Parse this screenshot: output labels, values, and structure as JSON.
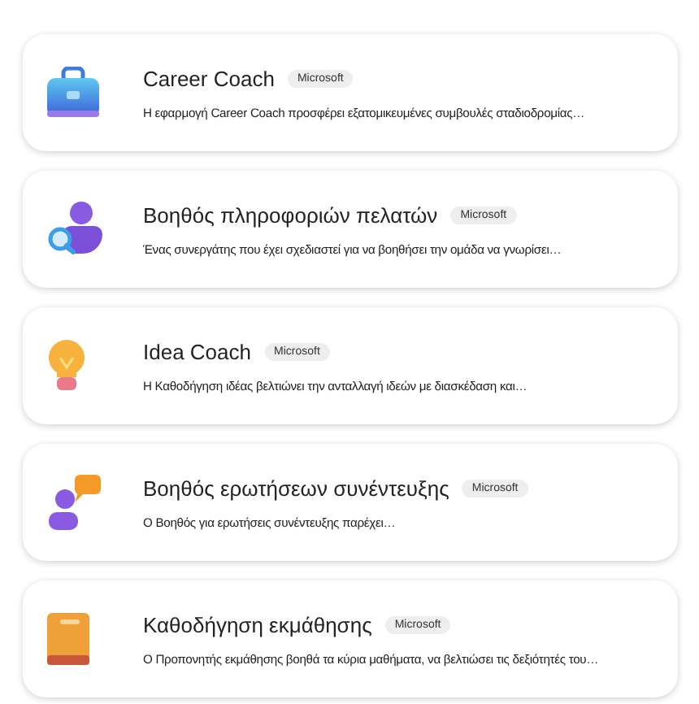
{
  "agents": [
    {
      "icon": {
        "kind": "briefcase"
      },
      "name": "Career Coach",
      "badge": "Microsoft",
      "description": "Η εφαρμογή Career Coach προσφέρει εξατομικευμένες συμβουλές σταδιοδρομίας…"
    },
    {
      "icon": {
        "kind": "person-search"
      },
      "name": "Βοηθός πληροφοριών πελατών",
      "badge": "Microsoft",
      "description": "Ένας συνεργάτης που έχει σχεδιαστεί για να βοηθήσει την ομάδα να γνωρίσει…"
    },
    {
      "icon": {
        "kind": "bulb"
      },
      "name": "Idea Coach",
      "badge": "Microsoft",
      "description": "Η Καθοδήγηση ιδέας βελτιώνει την ανταλλαγή ιδεών με διασκέδαση και…"
    },
    {
      "icon": {
        "kind": "chat-person"
      },
      "name": "Βοηθός ερωτήσεων συνέντευξης",
      "badge": "Microsoft",
      "description": "Ο Βοηθός για ερωτήσεις συνέντευξης παρέχει…"
    },
    {
      "icon": {
        "kind": "book"
      },
      "name": "Καθοδήγηση εκμάθησης",
      "badge": "Microsoft",
      "description": "Ο Προπονητής εκμάθησης βοηθά τα κύρια μαθήματα, να βελτιώσει τις δεξιότητές του…"
    }
  ]
}
